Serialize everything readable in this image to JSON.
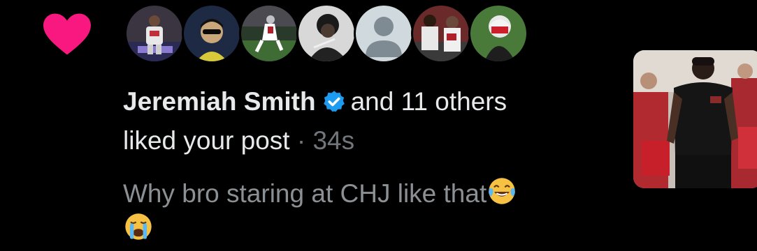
{
  "notification": {
    "type_icon": "heart-icon",
    "accent_color": "#f91880",
    "avatar_count": 7,
    "liker_name": "Jeremiah Smith",
    "verified_icon": "verified-badge-icon",
    "verified_color": "#1d9bf0",
    "others_text": "and 11 others",
    "action_text": "liked your post",
    "separator": "·",
    "timestamp": "34s",
    "post_preview": "Why bro staring at CHJ like that",
    "preview_emojis": [
      "face-with-tears-of-joy",
      "loudly-crying-face"
    ]
  }
}
